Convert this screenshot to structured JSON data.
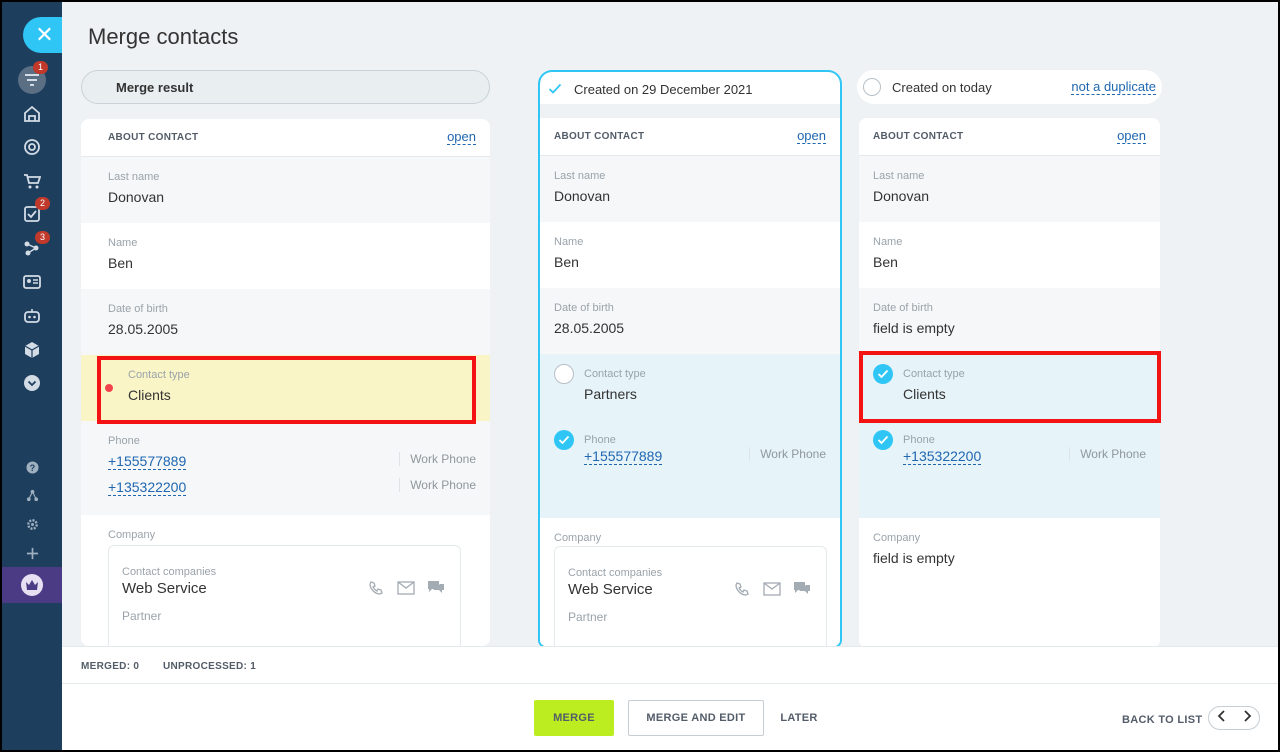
{
  "page": {
    "title": "Merge contacts"
  },
  "sidebar": {
    "badges": {
      "filter": "1",
      "tasks": "2",
      "sites": "3"
    }
  },
  "columns": {
    "result": {
      "header": "Merge result",
      "section_title": "ABOUT CONTACT",
      "open_label": "open",
      "fields": {
        "last_name": {
          "label": "Last name",
          "value": "Donovan"
        },
        "name": {
          "label": "Name",
          "value": "Ben"
        },
        "dob": {
          "label": "Date of birth",
          "value": "28.05.2005"
        },
        "contact_type": {
          "label": "Contact type",
          "value": "Clients"
        },
        "phone": {
          "label": "Phone"
        },
        "company": {
          "label": "Company"
        }
      },
      "phones": [
        {
          "number": "+155577889",
          "type": "Work Phone"
        },
        {
          "number": "+135322200",
          "type": "Work Phone"
        }
      ],
      "company_card": {
        "label": "Contact companies",
        "name": "Web Service",
        "role": "Partner"
      }
    },
    "dup1": {
      "header": "Created on 29 December 2021",
      "section_title": "ABOUT CONTACT",
      "open_label": "open",
      "fields": {
        "last_name": {
          "label": "Last name",
          "value": "Donovan"
        },
        "name": {
          "label": "Name",
          "value": "Ben"
        },
        "dob": {
          "label": "Date of birth",
          "value": "28.05.2005"
        },
        "contact_type": {
          "label": "Contact type",
          "value": "Partners"
        },
        "phone": {
          "label": "Phone",
          "number": "+155577889",
          "type": "Work Phone"
        },
        "company": {
          "label": "Company"
        }
      },
      "company_card": {
        "label": "Contact companies",
        "name": "Web Service",
        "role": "Partner"
      }
    },
    "dup2": {
      "header": "Created on today",
      "not_duplicate": "not a duplicate",
      "section_title": "ABOUT CONTACT",
      "open_label": "open",
      "fields": {
        "last_name": {
          "label": "Last name",
          "value": "Donovan"
        },
        "name": {
          "label": "Name",
          "value": "Ben"
        },
        "dob": {
          "label": "Date of birth",
          "value": "field is empty"
        },
        "contact_type": {
          "label": "Contact type",
          "value": "Clients"
        },
        "phone": {
          "label": "Phone",
          "number": "+135322200",
          "type": "Work Phone"
        },
        "company": {
          "label": "Company",
          "value": "field is empty"
        }
      }
    }
  },
  "stats": {
    "merged": "MERGED:  0",
    "unprocessed": "UNPROCESSED:  1"
  },
  "actions": {
    "merge": "MERGE",
    "merge_edit": "MERGE AND EDIT",
    "later": "LATER",
    "back_to_list": "BACK TO LIST"
  },
  "colors": {
    "accent": "#2fc6f6",
    "merge_button": "#bbed21",
    "highlight": "#f41313",
    "sidebar": "#1e3e5e"
  }
}
